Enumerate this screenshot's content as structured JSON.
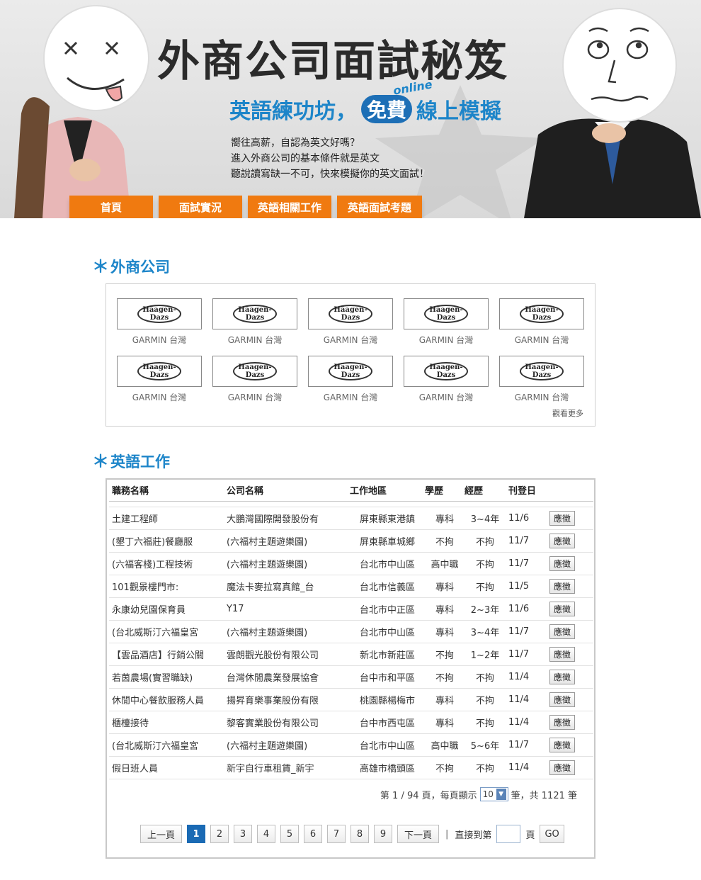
{
  "hero": {
    "title": "外商公司面試秘笈",
    "subtitle_left": "英語練功坊，",
    "subtitle_pill": "免費",
    "subtitle_right": "線上模擬",
    "online_tag": "online",
    "desc": [
      "嚮往高薪，自認為英文好嗎？",
      "進入外商公司的基本條件就是英文",
      "聽說讀寫缺一不可，快來模擬你的英文面試！"
    ]
  },
  "nav": {
    "items": [
      "首頁",
      "面試實況",
      "英語相關工作",
      "英語面試考題"
    ]
  },
  "companies": {
    "title": "外商公司",
    "asterisk": "＊",
    "logo_text": "Häagen-Dazs",
    "items": [
      "GARMIN 台灣",
      "GARMIN 台灣",
      "GARMIN 台灣",
      "GARMIN 台灣",
      "GARMIN 台灣",
      "GARMIN 台灣",
      "GARMIN 台灣",
      "GARMIN 台灣",
      "GARMIN 台灣",
      "GARMIN 台灣"
    ],
    "more": "觀看更多"
  },
  "jobs": {
    "title": "英語工作",
    "asterisk": "＊",
    "headers": [
      "職務名稱",
      "公司名稱",
      "工作地區",
      "學歷",
      "經歷",
      "刊登日",
      ""
    ],
    "apply_label": "應徵",
    "rows": [
      [
        "土建工程師",
        "大鵬灣國際開發股份有",
        "屏東縣東港鎮",
        "專科",
        "3~4年",
        "11/6"
      ],
      [
        "(墾丁六福莊)餐廳服",
        "(六福村主題遊樂園)",
        "屏東縣車城鄉",
        "不拘",
        "不拘",
        "11/7"
      ],
      [
        "(六福客棧)工程技術",
        "(六福村主題遊樂園)",
        "台北市中山區",
        "高中職",
        "不拘",
        "11/7"
      ],
      [
        "101觀景樓門市:",
        "魔法卡麥拉寫真館_台",
        "台北市信義區",
        "專科",
        "不拘",
        "11/5"
      ],
      [
        "永康幼兒園保育員",
        "Y17",
        "台北市中正區",
        "專科",
        "2~3年",
        "11/6"
      ],
      [
        "(台北威斯汀六福皇宮",
        "(六福村主題遊樂園)",
        "台北市中山區",
        "專科",
        "3~4年",
        "11/7"
      ],
      [
        "【雲品酒店】行銷公關",
        "雲朗觀光股份有限公司",
        "新北市新莊區",
        "不拘",
        "1~2年",
        "11/7"
      ],
      [
        "若茵農場(實習職缺)",
        "台灣休閒農業發展協會",
        "台中市和平區",
        "不拘",
        "不拘",
        "11/4"
      ],
      [
        "休閒中心餐飲服務人員",
        "揚昇育樂事業股份有限",
        "桃園縣楊梅市",
        "專科",
        "不拘",
        "11/4"
      ],
      [
        "櫃檯接待",
        "黎客實業股份有限公司",
        "台中市西屯區",
        "專科",
        "不拘",
        "11/4"
      ],
      [
        "(台北威斯汀六福皇宮",
        "(六福村主題遊樂園)",
        "台北市中山區",
        "高中職",
        "5~6年",
        "11/7"
      ],
      [
        "假日班人員",
        "新宇自行車租賃_新宇",
        "高雄市橋頭區",
        "不拘",
        "不拘",
        "11/4"
      ]
    ],
    "pager_info": {
      "prefix": "第 1 / 94 頁，每頁顯示",
      "per_page": "10",
      "suffix": "筆，共 1121 筆"
    },
    "pager": {
      "prev": "上一頁",
      "pages": [
        "1",
        "2",
        "3",
        "4",
        "5",
        "6",
        "7",
        "8",
        "9"
      ],
      "next": "下一頁",
      "sep": "|",
      "goto_label": "直接到第",
      "goto_unit": "頁",
      "go": "GO"
    }
  }
}
